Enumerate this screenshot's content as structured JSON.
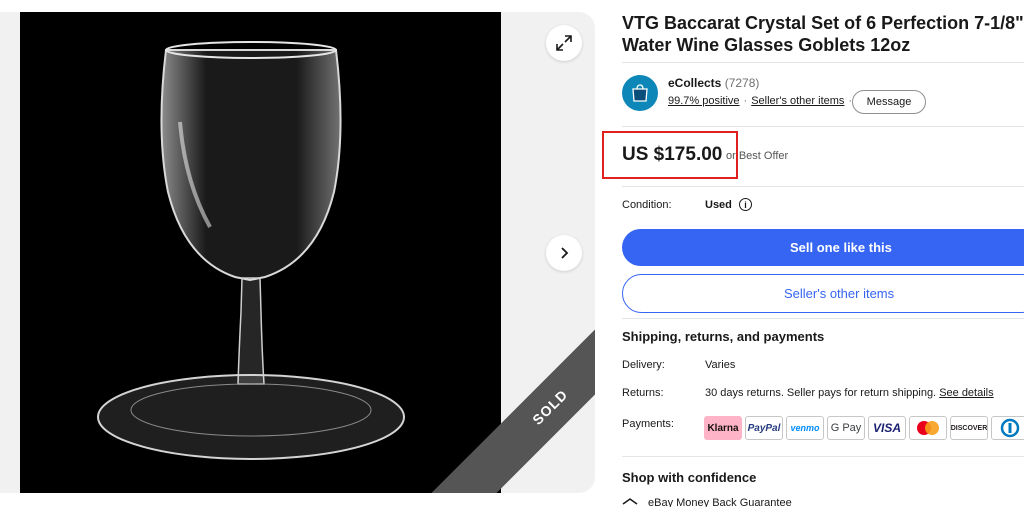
{
  "gallery": {
    "sold_label": "SOLD",
    "expand_icon": "expand-icon",
    "next_icon": "chevron-right-icon"
  },
  "listing": {
    "title": "VTG Baccarat Crystal Set of 6 Perfection 7-1/8\" Water Wine Glasses Goblets 12oz",
    "price": "US $175.00",
    "best_offer": "or Best Offer"
  },
  "seller": {
    "name": "eCollects",
    "feedback_count": "(7278)",
    "positive": "99.7% positive",
    "other_items_link": "Seller's other items",
    "message_button": "Message"
  },
  "condition": {
    "label": "Condition:",
    "value": "Used"
  },
  "actions": {
    "primary": "Sell one like this",
    "secondary": "Seller's other items"
  },
  "shipping": {
    "heading": "Shipping, returns, and payments",
    "delivery_label": "Delivery:",
    "delivery_value": "Varies",
    "returns_label": "Returns:",
    "returns_value": "30 days returns. Seller pays for return shipping. ",
    "returns_link": "See details",
    "payments_label": "Payments:",
    "payments": [
      "Klarna",
      "PayPal",
      "venmo",
      "G Pay",
      "VISA",
      "mastercard-icon",
      "DISCOVER",
      "diners-icon"
    ]
  },
  "confidence": {
    "heading": "Shop with confidence",
    "guarantee": "eBay Money Back Guarantee"
  },
  "colors": {
    "accent": "#3665f3",
    "highlight": "#e0201e",
    "klarna": "#ffb3c7"
  }
}
